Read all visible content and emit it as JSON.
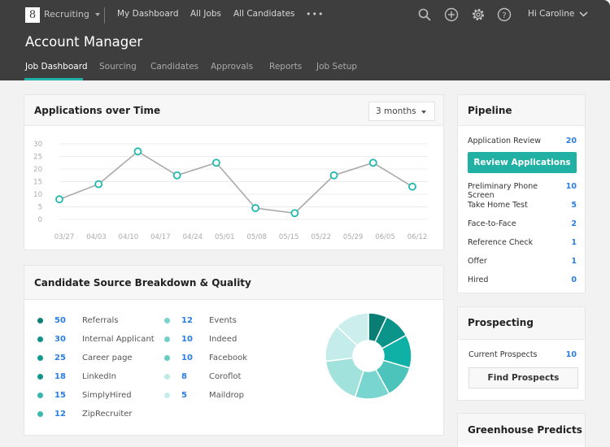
{
  "topbar": {
    "logo_glyph": "8",
    "app_name": "Recruiting",
    "nav": [
      "My Dashboard",
      "All Jobs",
      "All Candidates"
    ],
    "more": "•••",
    "icons": [
      "search-icon",
      "add-icon",
      "gear-icon",
      "help-icon"
    ],
    "user_greeting": "Hi Caroline"
  },
  "header": {
    "title": "Account Manager",
    "tabs": [
      {
        "label": "Job Dashboard",
        "active": true
      },
      {
        "label": "Sourcing",
        "active": false
      },
      {
        "label": "Candidates",
        "active": false
      },
      {
        "label": "Approvals",
        "active": false
      },
      {
        "label": "Reports",
        "active": false
      },
      {
        "label": "Job Setup",
        "active": false
      }
    ]
  },
  "applications_card": {
    "title": "Applications over Time",
    "range_select": "3 months"
  },
  "chart_data": {
    "type": "line",
    "title": "Applications over Time",
    "xlabel": "",
    "ylabel": "",
    "x": [
      "03/27",
      "04/03",
      "04/10",
      "04/17",
      "04/24",
      "05/01",
      "05/08",
      "05/15",
      "05/22",
      "05/29",
      "06/05",
      "06/12"
    ],
    "y_ticks": [
      0,
      5,
      10,
      15,
      20,
      25,
      30
    ],
    "ylim": [
      0,
      30
    ],
    "grid": true,
    "series": [
      {
        "name": "Applications",
        "values": [
          8,
          14,
          27,
          17.5,
          22.5,
          4.5,
          2.5,
          17.5,
          22.5,
          13
        ],
        "x_positions": [
          0,
          1,
          2,
          3,
          4,
          5,
          6,
          7,
          8,
          9
        ]
      }
    ],
    "point_x_offsets_note": "points fall between weekly ticks"
  },
  "source_card": {
    "title": "Candidate Source Breakdown & Quality",
    "sources": [
      {
        "value": "50",
        "name": "Referrals",
        "color": "#0b7f78"
      },
      {
        "value": "30",
        "name": "Internal Applicant",
        "color": "#0e918a"
      },
      {
        "value": "25",
        "name": "Career page",
        "color": "#109a92"
      },
      {
        "value": "18",
        "name": "LinkedIn",
        "color": "#0f958d"
      },
      {
        "value": "15",
        "name": "SimplyHired",
        "color": "#35b7ae"
      },
      {
        "value": "12",
        "name": "ZipRecruiter",
        "color": "#3db9b0"
      },
      {
        "value": "12",
        "name": "Events",
        "color": "#78d3cc"
      },
      {
        "value": "10",
        "name": "Indeed",
        "color": "#72d0c9"
      },
      {
        "value": "10",
        "name": "Facebook",
        "color": "#65cbc3"
      },
      {
        "value": "8",
        "name": "Coroflot",
        "color": "#bfe9e5"
      },
      {
        "value": "5",
        "name": "Maildrop",
        "color": "#c8ecea"
      }
    ],
    "donut_segments": [
      {
        "fraction": 0.07,
        "color": "#0a7d74"
      },
      {
        "fraction": 0.1,
        "color": "#0b9489"
      },
      {
        "fraction": 0.125,
        "color": "#0fb0a6"
      },
      {
        "fraction": 0.125,
        "color": "#4cc4bb"
      },
      {
        "fraction": 0.13,
        "color": "#79d5cf"
      },
      {
        "fraction": 0.18,
        "color": "#a2e2dd"
      },
      {
        "fraction": 0.14,
        "color": "#c4ecea"
      },
      {
        "fraction": 0.13,
        "color": "#ccefed"
      }
    ]
  },
  "pipeline": {
    "title": "Pipeline",
    "stages": [
      {
        "label": "Application Review",
        "count": "20"
      },
      {
        "label": "Preliminary Phone Screen",
        "count": "10"
      },
      {
        "label": "Take Home Test",
        "count": "5"
      },
      {
        "label": "Face-to-Face",
        "count": "2"
      },
      {
        "label": "Reference Check",
        "count": "1"
      },
      {
        "label": "Offer",
        "count": "1"
      },
      {
        "label": "Hired",
        "count": "0"
      }
    ],
    "review_button": "Review Applications"
  },
  "prospecting": {
    "title": "Prospecting",
    "label": "Current Prospects",
    "count": "10",
    "button": "Find Prospects"
  },
  "predicts": {
    "title": "Greenhouse Predicts"
  },
  "colors": {
    "accent": "#21b1a4",
    "link_number": "#2a7ee0",
    "topbar": "#3e3e3e"
  }
}
